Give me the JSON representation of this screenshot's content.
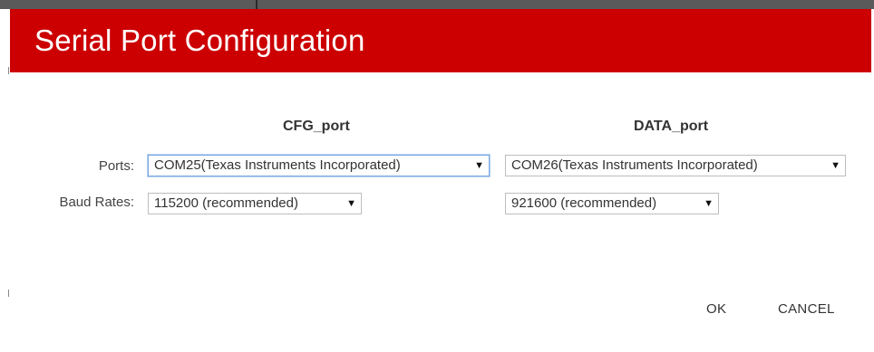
{
  "dialog": {
    "title": "Serial Port Configuration",
    "header_color": "#cc0000"
  },
  "columns": {
    "cfg_header": "CFG_port",
    "data_header": "DATA_port"
  },
  "rows": {
    "ports_label": "Ports:",
    "baud_label": "Baud Rates:"
  },
  "selects": {
    "cfg_port": "COM25(Texas Instruments Incorporated)",
    "data_port": "COM26(Texas Instruments Incorporated)",
    "cfg_baud": "115200 (recommended)",
    "data_baud": "921600 (recommended)",
    "arrow_glyph": "▼"
  },
  "buttons": {
    "ok": "OK",
    "cancel": "CANCEL"
  }
}
